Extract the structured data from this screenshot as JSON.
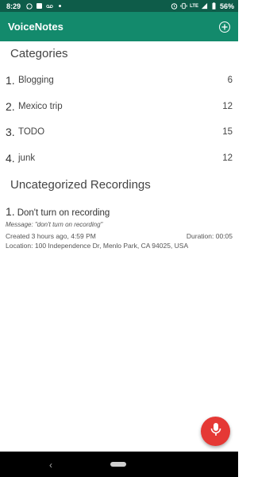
{
  "status": {
    "time": "8:29",
    "network": "LTE",
    "battery": "56%"
  },
  "app": {
    "title": "VoiceNotes"
  },
  "categories": {
    "header": "Categories",
    "items": [
      {
        "num": "1.",
        "name": "Blogging",
        "count": "6"
      },
      {
        "num": "2.",
        "name": "Mexico trip",
        "count": "12"
      },
      {
        "num": "3.",
        "name": "TODO",
        "count": "15"
      },
      {
        "num": "4.",
        "name": "junk",
        "count": "12"
      }
    ]
  },
  "uncategorized": {
    "header": "Uncategorized Recordings",
    "items": [
      {
        "num": "1.",
        "name": "Don't turn on recording",
        "message": "Message: \"don't turn on recording\"",
        "created": "Created 3 hours ago, 4:59 PM",
        "duration": "Duration: 00:05",
        "location": "Location: 100 Independence Dr, Menlo Park, CA 94025, USA"
      }
    ]
  },
  "colors": {
    "status_bar": "#0e5c49",
    "app_bar": "#138a6c",
    "fab": "#e53935"
  },
  "icons": {
    "status": [
      "whatsapp-icon",
      "image-icon",
      "voicemail-icon",
      "dot-icon",
      "alarm-icon",
      "vibrate-icon",
      "signal-icon",
      "battery-icon"
    ],
    "app_bar_action": "add-circle-icon",
    "fab": "microphone-icon",
    "nav": [
      "back-icon",
      "home-pill-icon"
    ]
  }
}
